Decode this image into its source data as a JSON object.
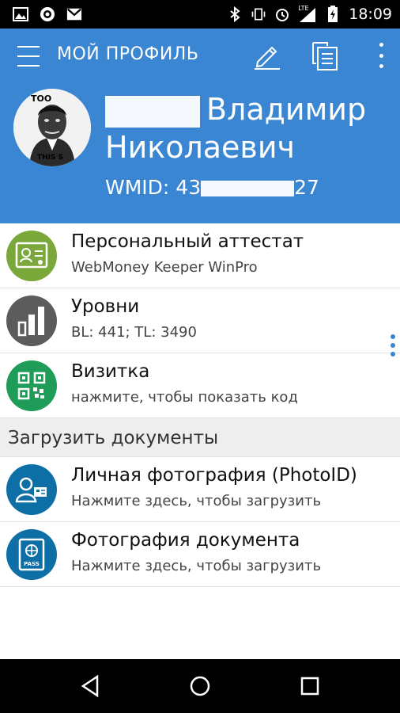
{
  "status_bar": {
    "time": "18:09",
    "network_label": "LTE",
    "icons_left": [
      "image-icon",
      "webmoney-icon",
      "gmail-icon"
    ],
    "icons_right": [
      "bluetooth-icon",
      "vibrate-icon",
      "alarm-icon",
      "signal-icon",
      "battery-icon"
    ]
  },
  "app_bar": {
    "title": "МОЙ ПРОФИЛЬ",
    "menu_icon": "hamburger-icon",
    "edit_icon": "pencil-icon",
    "copy_icon": "copy-document-icon",
    "more_icon": "more-vert-icon"
  },
  "profile": {
    "name_line1_visible": "Владимир",
    "name_line2": "Николаевич",
    "wmid_label": "WMID:",
    "wmid_start": "43",
    "wmid_end": "27",
    "avatar_text_top": "TOO",
    "avatar_text_bottom": "THIS S"
  },
  "items": [
    {
      "title": "Персональный аттестат",
      "subtitle": "WebMoney Keeper WinPro",
      "icon": "certificate-icon",
      "color": "#7aa83b"
    },
    {
      "title": "Уровни",
      "subtitle": "BL: 441; TL: 3490",
      "icon": "bar-chart-icon",
      "color": "#5c5c5c"
    },
    {
      "title": "Визитка",
      "subtitle": "нажмите, чтобы показать код",
      "icon": "qr-code-icon",
      "color": "#1e9c58"
    }
  ],
  "section_header": "Загрузить документы",
  "documents": [
    {
      "title": "Личная фотография (PhotoID)",
      "subtitle": "Нажмите здесь, чтобы загрузить",
      "icon": "photo-id-icon",
      "color": "#0d6fa6"
    },
    {
      "title": "Фотография документа",
      "subtitle": "Нажмите здесь, чтобы загрузить",
      "icon": "passport-icon",
      "color": "#0d6fa6"
    }
  ],
  "nav": {
    "back": "back-icon",
    "home": "home-icon",
    "recents": "recents-icon"
  }
}
